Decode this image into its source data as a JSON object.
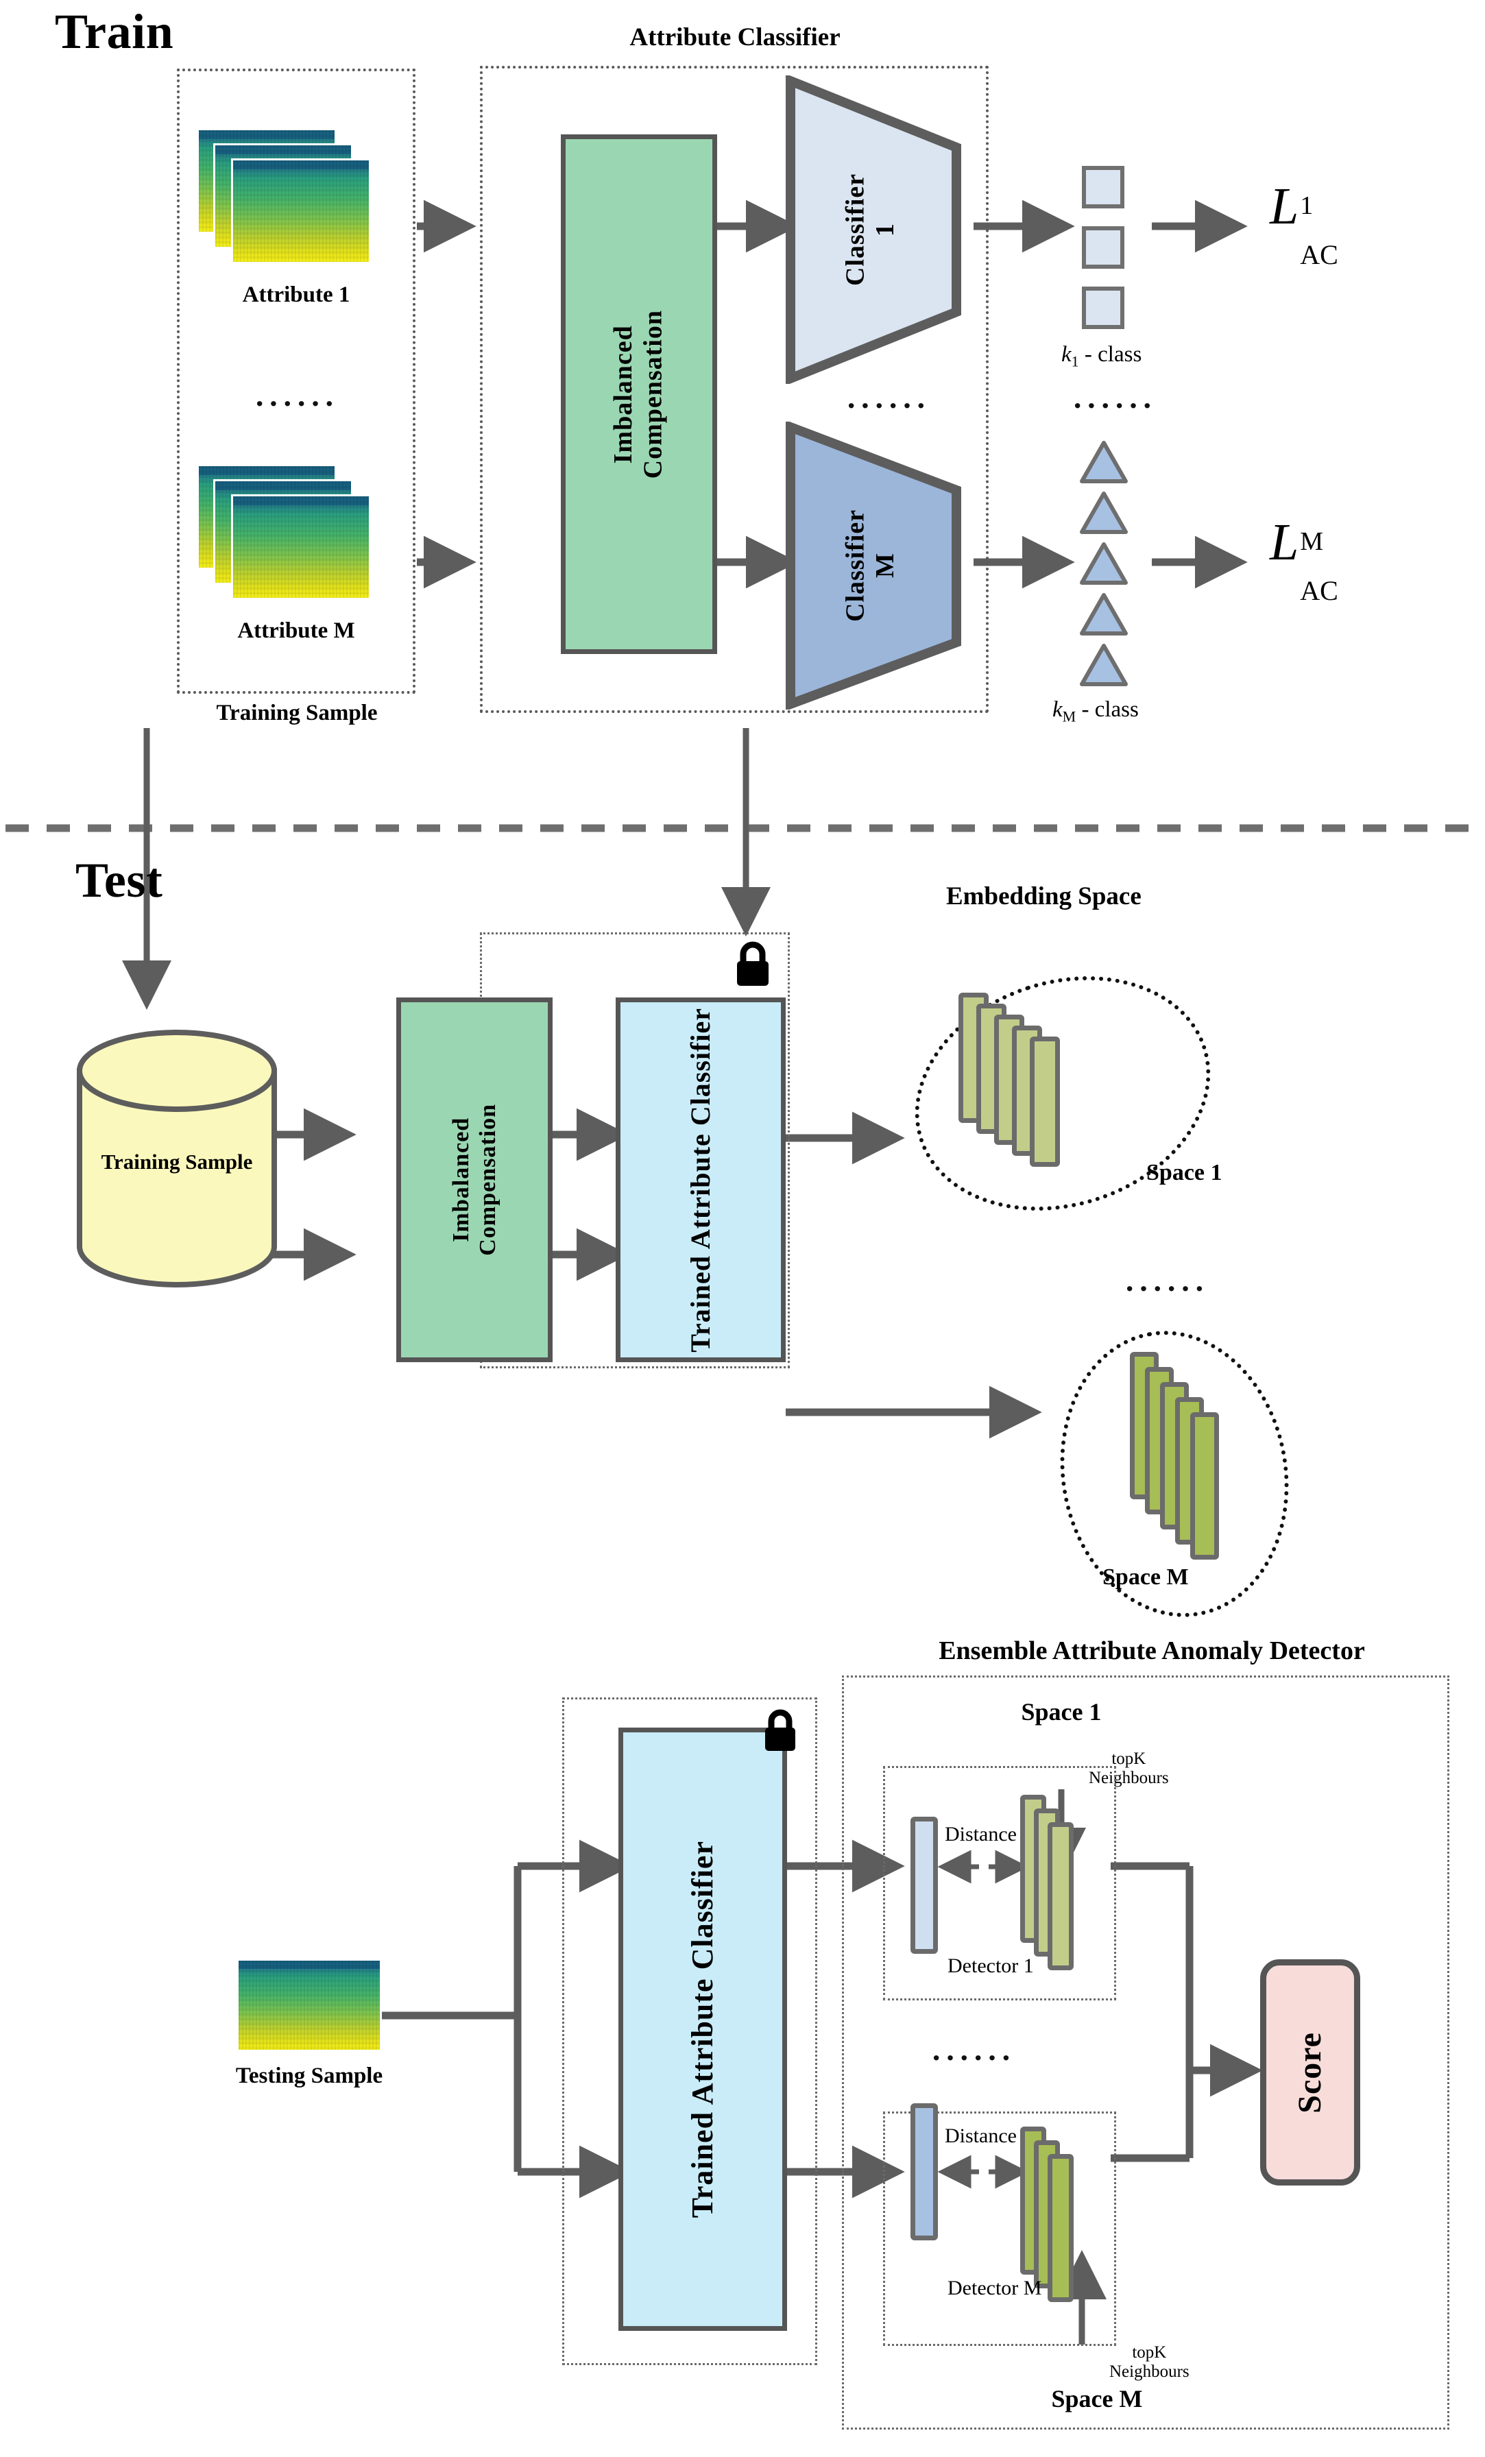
{
  "diagram": {
    "title_train": "Train",
    "title_test": "Test"
  },
  "train": {
    "group_training_sample_label": "Training Sample",
    "attribute_1_label": "Attribute 1",
    "attribute_m_label": "Attribute M",
    "ellipsis": "······",
    "imbalanced_compensation_label": "Imbalanced\nCompensation",
    "attribute_classifier_group_label": "Attribute Classifier",
    "classifier_1_label": "Classifier\n1",
    "classifier_m_label": "Classifier\nM",
    "k1_class_label": "k₁ - class",
    "km_class_label": "kM - class",
    "loss_1": "L",
    "loss_1_sup": "1",
    "loss_1_sub": "AC",
    "loss_m": "L",
    "loss_m_sup": "M",
    "loss_m_sub": "AC"
  },
  "test": {
    "training_sample_db_label": "Training Sample",
    "imbalanced_compensation_label": "Imbalanced\nCompensation",
    "trained_attribute_classifier_label": "Trained Attribute Classifier",
    "embedding_space_label": "Embedding Space",
    "space_1_label": "Space 1",
    "space_m_label": "Space M",
    "ellipsis": "······",
    "lock_icon": "lock-icon"
  },
  "detector": {
    "testing_sample_label": "Testing Sample",
    "trained_attribute_classifier_label": "Trained Attribute Classifier",
    "ensemble_group_label": "Ensemble Attribute Anomaly Detector",
    "space_1_label": "Space 1",
    "space_m_label": "Space M",
    "topk_label_1": "topK\nNeighbours",
    "topk_label_m": "topK\nNeighbours",
    "distance_label_1": "Distance",
    "distance_label_m": "Distance",
    "detector_1_label": "Detector 1",
    "detector_m_label": "Detector M",
    "score_label": "Score",
    "ellipsis": "······",
    "lock_icon": "lock-icon"
  },
  "colors": {
    "green_block": "#9bd6b2",
    "blue_block": "#c9ecf8",
    "classifier_1": "#dbe5f1",
    "classifier_m": "#9cb6da",
    "score_block": "#f7dcd9",
    "database": "#fbf8bd",
    "embedding_bar_1": "#c3cd8a",
    "embedding_bar_m": "#a7bd55",
    "stroke": "#555555"
  }
}
